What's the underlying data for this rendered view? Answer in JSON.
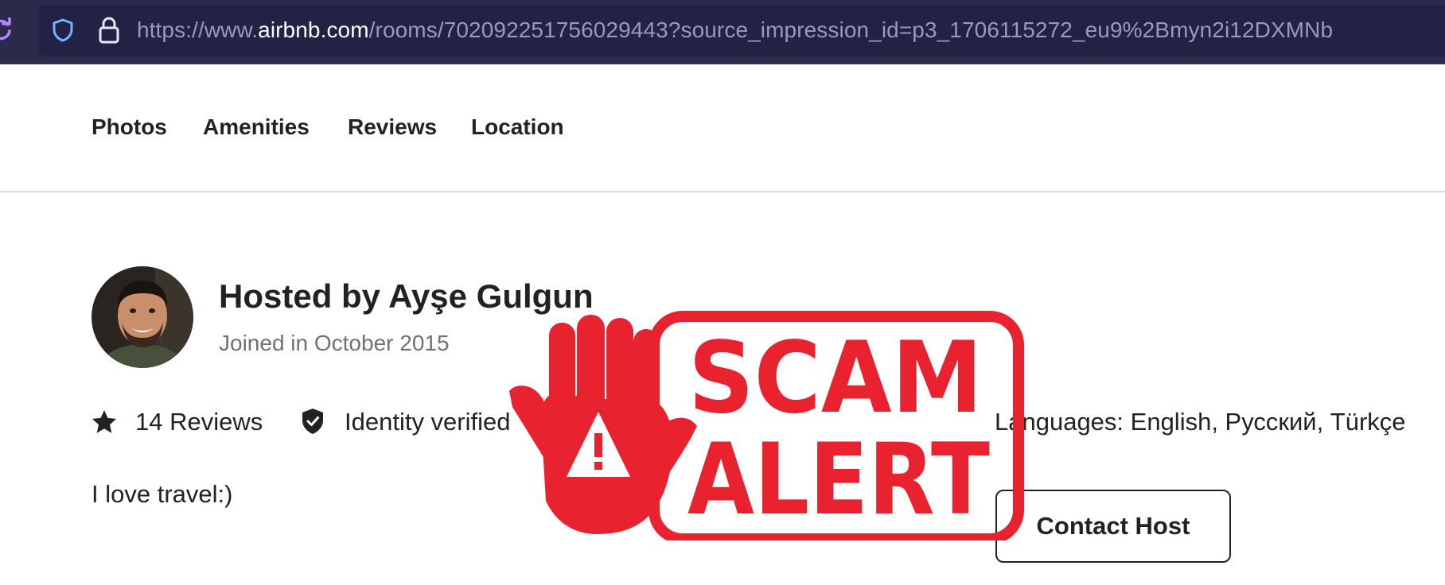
{
  "browser": {
    "url_prefix": "https://www.",
    "url_domain": "airbnb.com",
    "url_path": "/rooms/702092251756029443?source_impression_id=p3_1706115272_eu9%2Bmyn2i12DXMNb"
  },
  "subnav": {
    "items": [
      "Photos",
      "Amenities",
      "Reviews",
      "Location"
    ]
  },
  "host": {
    "title": "Hosted by Ayşe Gulgun",
    "joined": "Joined in October 2015",
    "reviews": "14 Reviews",
    "identity": "Identity verified",
    "languages": "Languages: English, Русский, Türkçe",
    "bio": "I love travel:)",
    "contact_label": "Contact Host"
  },
  "stamp": {
    "line1": "SCAM",
    "line2": "ALERT",
    "color": "#e8232f"
  },
  "colors": {
    "browser_bar": "#2b2a4a",
    "url_muted": "#9a98c2",
    "text": "#222222",
    "muted": "#717171"
  },
  "icons": [
    "reload-icon",
    "shield-icon",
    "lock-icon",
    "star-icon",
    "verified-icon",
    "stop-hand-icon",
    "warning-triangle-icon"
  ]
}
